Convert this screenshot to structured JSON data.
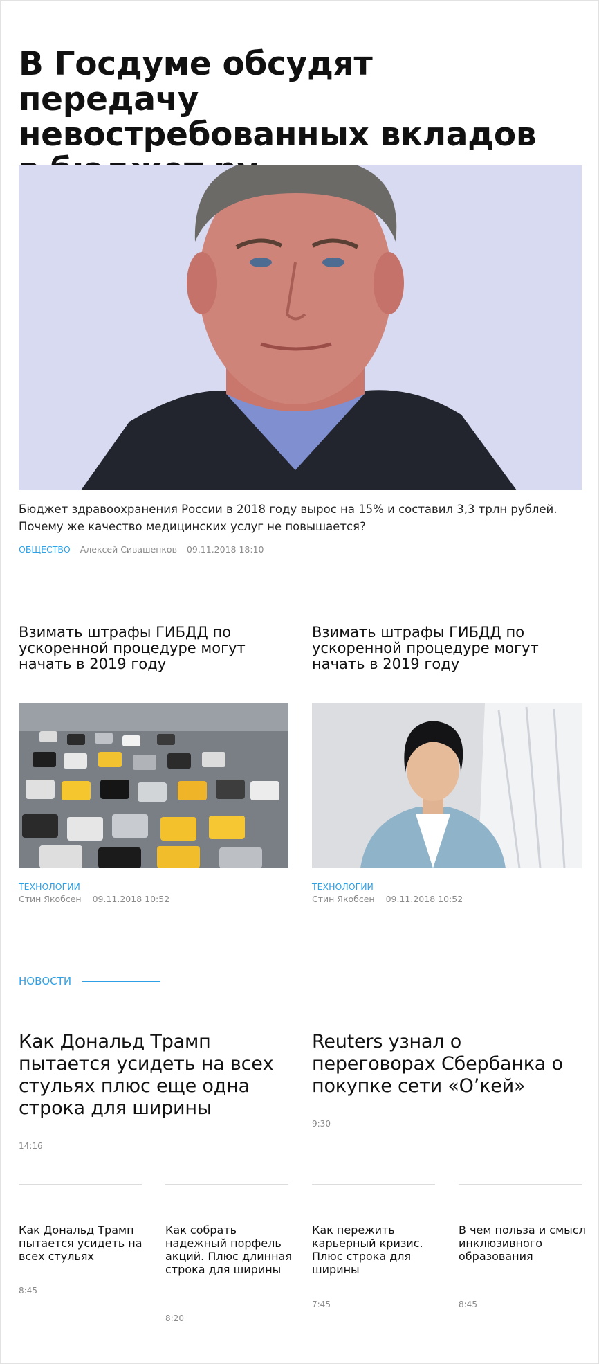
{
  "lead": {
    "title": "В Госдуме обсудят передачу невостребованных вкладов в бюджет ру",
    "description": "Бюджет здравоохранения России в 2018 году вырос на 15% и составил 3,3 трлн рублей. Почему же качество медицинских услуг не повышается?",
    "rubric": "ОБЩЕСТВО",
    "author": "Алексей Сивашенков",
    "datetime": "09.11.2018 18:10"
  },
  "cards": [
    {
      "title": "Взимать штрафы ГИБДД по ускоренной процедуре могут начать в 2019 году",
      "rubric": "ТЕХНОЛОГИИ",
      "author": "Стин Якобсен",
      "datetime": "09.11.2018 10:52"
    },
    {
      "title": "Взимать штрафы ГИБДД по ускоренной процедуре могут начать в 2019 году",
      "rubric": "ТЕХНОЛОГИИ",
      "author": "Стин Якобсен",
      "datetime": "09.11.2018 10:52"
    }
  ],
  "news": {
    "section_label": "НОВОСТИ",
    "big": [
      {
        "title": "Как Дональд Трамп пытается усидеть на всех стульях плюс еще одна строка для ширины",
        "time": "14:16"
      },
      {
        "title": "Reuters узнал о переговорах Сбербанка о покупке сети «О’кей»",
        "time": "9:30"
      }
    ],
    "small": [
      {
        "title": "Как Дональд Трамп пытается усидеть на всех стульях",
        "time": "8:45"
      },
      {
        "title": "Как собрать надежный порфель акций. Плюс длинная строка для ширины",
        "time": "8:20"
      },
      {
        "title": "Как пережить карьерный кризис. Плюс строка для ширины",
        "time": "7:45"
      },
      {
        "title": "В чем польза и смысл инклюзивного образования",
        "time": "8:45"
      }
    ]
  },
  "colors": {
    "accent": "#2ea0e6",
    "text": "#111111",
    "meta": "#8a8a8a"
  }
}
